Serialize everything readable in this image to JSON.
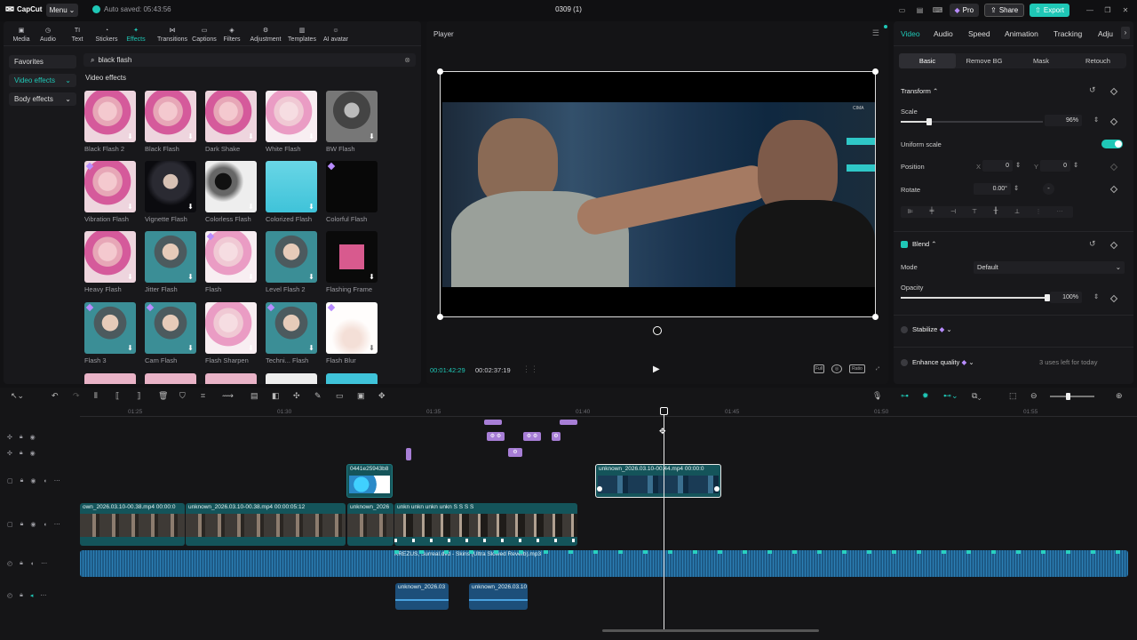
{
  "titlebar": {
    "logo": "CapCut",
    "menu": "Menu",
    "autosave": "Auto saved: 05:43:56",
    "project_title": "0309 (1)",
    "pro": "Pro",
    "share": "Share",
    "export": "Export"
  },
  "toolbar": {
    "items": [
      "Media",
      "Audio",
      "Text",
      "Stickers",
      "Effects",
      "Transitions",
      "Captions",
      "Filters",
      "Adjustment",
      "Templates",
      "AI avatar"
    ],
    "active": "Effects"
  },
  "categories": {
    "favorites": "Favorites",
    "video_effects": "Video effects",
    "body_effects": "Body effects"
  },
  "search": {
    "value": "black flash"
  },
  "effects": {
    "section_title": "Video effects",
    "items": [
      {
        "label": "Black Flash 2"
      },
      {
        "label": "Black Flash"
      },
      {
        "label": "Dark Shake"
      },
      {
        "label": "White Flash"
      },
      {
        "label": "BW Flash"
      },
      {
        "label": "Vibration Flash"
      },
      {
        "label": "Vignette Flash"
      },
      {
        "label": "Colorless Flash"
      },
      {
        "label": "Colorized Flash"
      },
      {
        "label": "Colorful Flash"
      },
      {
        "label": "Heavy Flash"
      },
      {
        "label": "Jitter Flash"
      },
      {
        "label": "Flash"
      },
      {
        "label": "Level Flash 2"
      },
      {
        "label": "Flashing Frame"
      },
      {
        "label": "Flash 3"
      },
      {
        "label": "Cam Flash"
      },
      {
        "label": "Flash Sharpen"
      },
      {
        "label": "Techni... Flash"
      },
      {
        "label": "Flash Blur"
      }
    ]
  },
  "player": {
    "title": "Player",
    "time_current": "00:01:42:29",
    "time_total": "00:02:37:19",
    "tools": [
      "Full",
      "Ratio"
    ]
  },
  "right_panel": {
    "tabs": [
      "Video",
      "Audio",
      "Speed",
      "Animation",
      "Tracking",
      "Adju"
    ],
    "active_tab": "Video",
    "sub_tabs": [
      "Basic",
      "Remove BG",
      "Mask",
      "Retouch"
    ],
    "active_sub_tab": "Basic",
    "transform_label": "Transform",
    "scale_label": "Scale",
    "scale_value": "96%",
    "scale_fraction": 0.2,
    "uniform_scale_label": "Uniform scale",
    "position_label": "Position",
    "pos_x_label": "X",
    "pos_x": "0",
    "pos_y_label": "Y",
    "pos_y": "0",
    "rotate_label": "Rotate",
    "rotate_value": "0.00°",
    "blend_label": "Blend",
    "mode_label": "Mode",
    "mode_value": "Default",
    "opacity_label": "Opacity",
    "opacity_value": "100%",
    "stabilize_label": "Stabilize",
    "enhance_label": "Enhance quality",
    "uses_left": "3 uses left for today"
  },
  "timeline": {
    "ruler_ticks": [
      "01:25",
      "01:30",
      "01:35",
      "01:40",
      "01:45",
      "01:50",
      "01:55"
    ],
    "clips": {
      "overlay_small": "0441e25943b8",
      "overlay_main": "unknown_2026.03.10-00.44.mp4   00:00:0",
      "video_1": "own_2026.03.10-00.38.mp4   00:00:0",
      "video_2": "unknown_2026.03.10-00.38.mp4   00:00:05:12",
      "video_3": "unknown_2026",
      "video_4": "unkn  unkn  unkn  unkn  S  S  S  S",
      "audio_main": "KREZUS, Surreal.dvd - Skins (Ultra Slowed  Reverb).mp3",
      "audio_small_1": "unknown_2026.03",
      "audio_small_2": "unknown_2026.03.10"
    }
  }
}
